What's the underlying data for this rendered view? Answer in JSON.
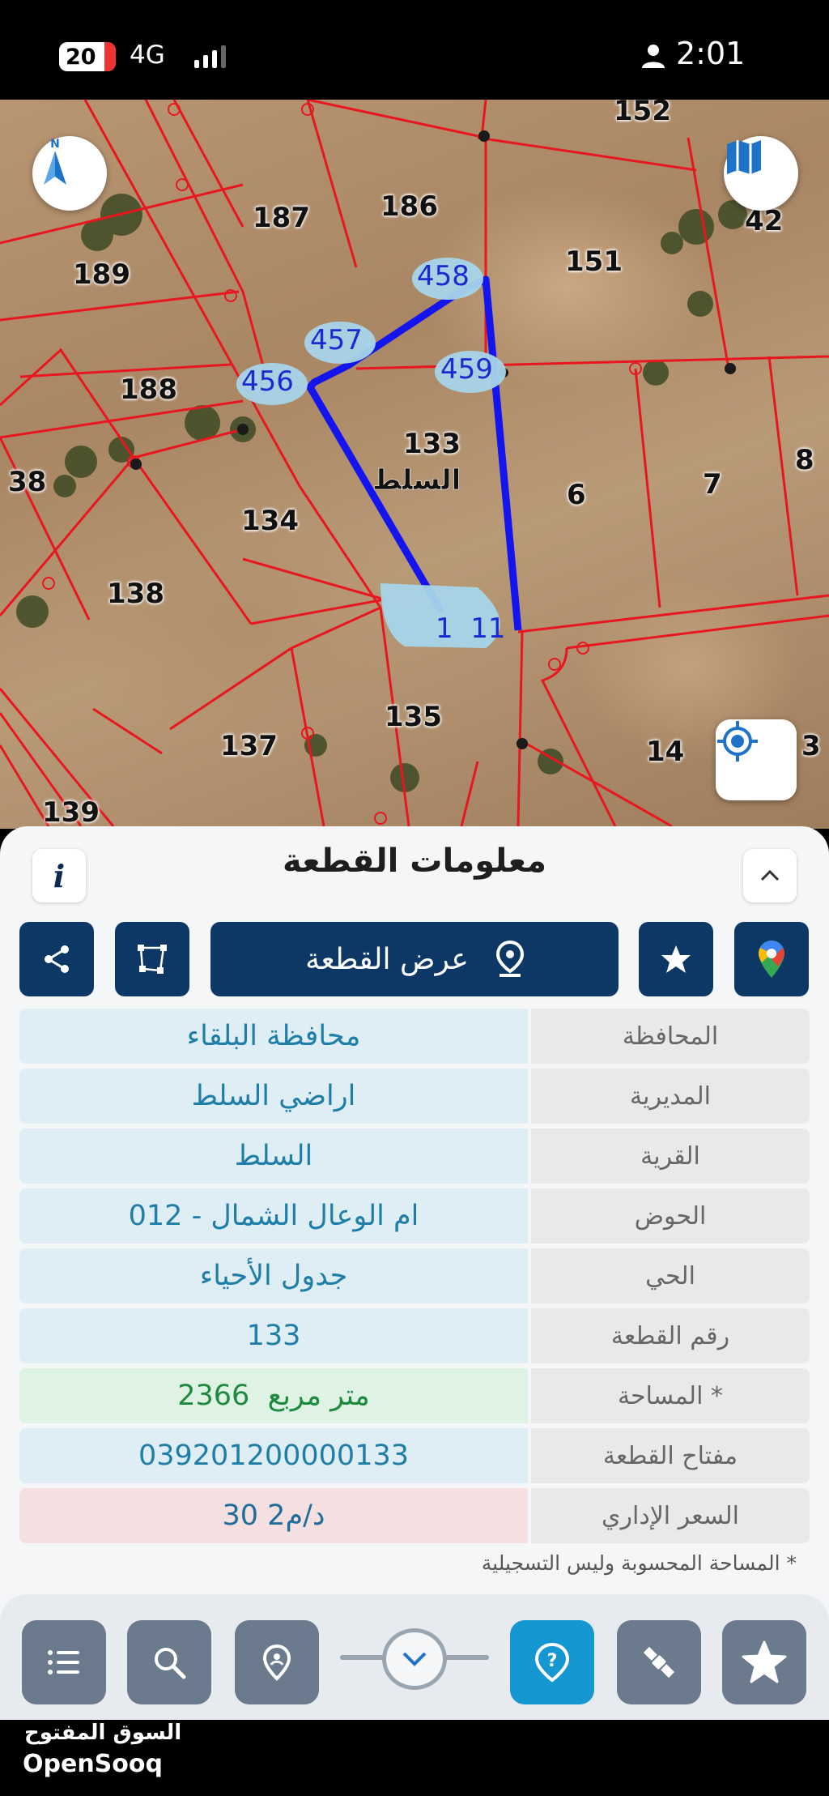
{
  "status_bar": {
    "notification_count": "20",
    "network": "4G",
    "time": "2:01"
  },
  "map": {
    "parcel_labels": [
      "152",
      "186",
      "187",
      "189",
      "42",
      "151",
      "188",
      "38",
      "133",
      "134",
      "6",
      "7",
      "8",
      "138",
      "135",
      "137",
      "14",
      "3",
      "139"
    ],
    "point_labels": [
      "458",
      "457",
      "456",
      "459",
      "1  11"
    ],
    "area_name": "السلط",
    "compass_label": "N",
    "icons": [
      "north-compass-icon",
      "map-book-icon",
      "my-location-icon"
    ],
    "colors": {
      "parcel_lines": "#e8161f",
      "selected_boundary": "#1414ee",
      "point_label_bg": "#a7d5ea"
    }
  },
  "sheet": {
    "title": "معلومات القطعة",
    "info_label": "i",
    "actions": {
      "show_parcel_label": "عرض القطعة"
    },
    "rows": [
      {
        "label": "المحافظة",
        "value": "محافظة البلقاء",
        "tone": "blue"
      },
      {
        "label": "المديرية",
        "value": "اراضي السلط",
        "tone": "blue"
      },
      {
        "label": "القرية",
        "value": "السلط",
        "tone": "blue"
      },
      {
        "label": "الحوض",
        "value": "ام الوعال الشمال - 012",
        "tone": "blue"
      },
      {
        "label": "الحي",
        "value": "جدول الأحياء",
        "tone": "blue"
      },
      {
        "label": "رقم القطعة",
        "value": "133",
        "tone": "blue"
      },
      {
        "label": "المساحة *",
        "value": "2366  متر مربع",
        "tone": "green"
      },
      {
        "label": "مفتاح القطعة",
        "value": "039201200000133",
        "tone": "blue"
      },
      {
        "label": "السعر الإداري",
        "value": "30 د/م2",
        "tone": "red"
      }
    ],
    "footnote": "* المساحة المحسوبة وليس التسجيلية"
  },
  "bottom_bar": {
    "icons": [
      "list-icon",
      "search-icon",
      "location-pin-icon",
      "chevron-down-icon",
      "help-icon",
      "satellite-icon",
      "favorites-icon"
    ],
    "colors": {
      "button": "#6b7a8c",
      "active": "#1597d2"
    }
  },
  "watermark": {
    "arabic": "السوق المفتوح",
    "english": "OpenSooq"
  }
}
